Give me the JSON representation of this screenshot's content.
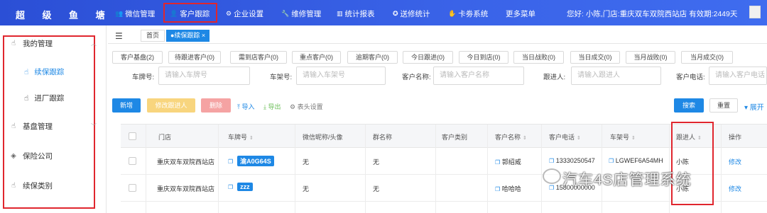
{
  "brand": "超 级 鱼 塘",
  "nav": [
    {
      "icon": "user-group-icon",
      "glyph": "👥",
      "label": "微信管理"
    },
    {
      "icon": "person-icon",
      "glyph": "👤",
      "label": "客户跟踪"
    },
    {
      "icon": "gear-icon",
      "glyph": "⚙",
      "label": "企业设置"
    },
    {
      "icon": "wrench-icon",
      "glyph": "🔧",
      "label": "维修管理"
    },
    {
      "icon": "chart-icon",
      "glyph": "▥",
      "label": "统计报表"
    },
    {
      "icon": "award-icon",
      "glyph": "✪",
      "label": "送修统计"
    },
    {
      "icon": "card-icon",
      "glyph": "✋",
      "label": "卡劵系统"
    },
    {
      "icon": "",
      "glyph": "",
      "label": "更多菜单"
    }
  ],
  "welcome": "您好: 小陈,门店:重庆双车双院西站店 有效期:2449天",
  "sidebar": {
    "my_manage": "我的管理",
    "sub_items": [
      {
        "label": "续保跟踪"
      },
      {
        "label": "进厂跟踪"
      }
    ],
    "base_manage": "基盘管理",
    "insurance": "保险公司",
    "renewal_type": "续保类别"
  },
  "tabs": {
    "home": "首页",
    "current": "●续保跟踪 ×"
  },
  "chips": [
    "客户基盘(2)",
    "待跟进客户(0)",
    "需到店客户(0)",
    "重点客户(0)",
    "逾期客户(0)",
    "今日跟进(0)",
    "今日到店(0)",
    "当日战败(0)",
    "当日成交(0)",
    "当月战败(0)",
    "当月成交(0)"
  ],
  "filters": [
    {
      "label": "车牌号:",
      "placeholder": "请输入车牌号"
    },
    {
      "label": "车架号:",
      "placeholder": "请输入车架号"
    },
    {
      "label": "客户名称:",
      "placeholder": "请输入客户名称"
    },
    {
      "label": "跟进人:",
      "placeholder": "请输入跟进人"
    },
    {
      "label": "客户电话:",
      "placeholder": "请输入客户电话"
    }
  ],
  "toolbar": {
    "new": "新增",
    "edit_follower": "修改跟进人",
    "delete": "删除",
    "import": "⤒ 导入",
    "export": "⤓ 导出",
    "columns": "⚙ 表头设置",
    "search": "搜索",
    "reset": "重置",
    "expand": "▾ 展开"
  },
  "table": {
    "columns": [
      "门店",
      "车牌号",
      "微信昵称/头像",
      "群名称",
      "客户类别",
      "客户名称",
      "客户电话",
      "车架号",
      "跟进人",
      "操作"
    ],
    "rows": [
      {
        "store": "重庆双车双院西站店",
        "plate": "渝A0G64S",
        "wechat": "无",
        "group": "无",
        "category": "",
        "name": "郭绍威",
        "phone": "13330250547",
        "vin": "LGWEF6A54MH",
        "follower": "小陈",
        "op": "修改"
      },
      {
        "store": "重庆双车双院西站店",
        "plate": "zzz",
        "wechat": "无",
        "group": "无",
        "category": "",
        "name": "哈哈哈",
        "phone": "15800000000",
        "vin": "",
        "follower": "小陈",
        "op": "修改"
      }
    ]
  },
  "watermark": "汽车4S店管理系统",
  "colors": {
    "primary": "#1e88e5",
    "topbar": "#3a63e8",
    "highlight": "#e0262e"
  }
}
